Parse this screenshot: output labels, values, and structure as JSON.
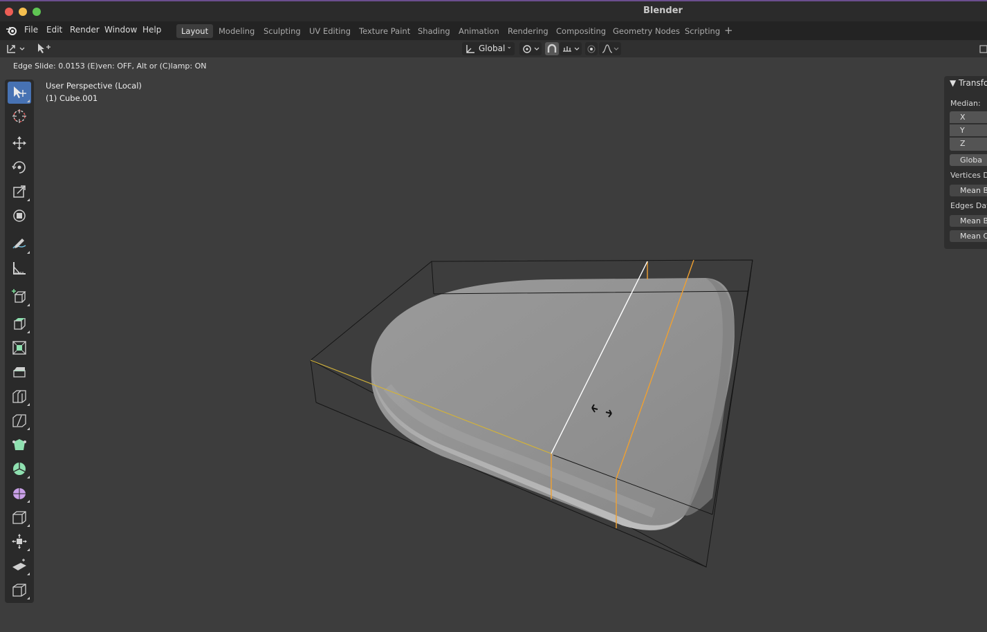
{
  "window": {
    "title": "Blender"
  },
  "menu": {
    "items": [
      "File",
      "Edit",
      "Render",
      "Window",
      "Help"
    ]
  },
  "workspaces": {
    "tabs": [
      "Layout",
      "Modeling",
      "Sculpting",
      "UV Editing",
      "Texture Paint",
      "Shading",
      "Animation",
      "Rendering",
      "Compositing",
      "Geometry Nodes",
      "Scripting"
    ],
    "active": "Layout",
    "add_label": "+"
  },
  "header": {
    "orientation": "Global",
    "orientation_chevron": "⌄"
  },
  "status": {
    "text": "Edge Slide: 0.0153 (E)ven: OFF, Alt or (C)lamp: ON"
  },
  "viewport": {
    "perspective": "User Perspective (Local)",
    "object": "(1) Cube.001"
  },
  "npanel": {
    "header": "▼  Transfo",
    "median_label": "Median:",
    "x": "X",
    "y": "Y",
    "z": "Z",
    "space_button": "Globa",
    "vertices_label": "Vertices D",
    "vertices_mean": "Mean B",
    "edges_label": "Edges Data",
    "edges_mean_b": "Mean B",
    "edges_mean_c": "Mean C"
  },
  "colors": {
    "active_tool": "#4772b3",
    "selected_edge": "#f0a030",
    "active_edge": "#ffffff",
    "bbox_edge": "#111111"
  }
}
